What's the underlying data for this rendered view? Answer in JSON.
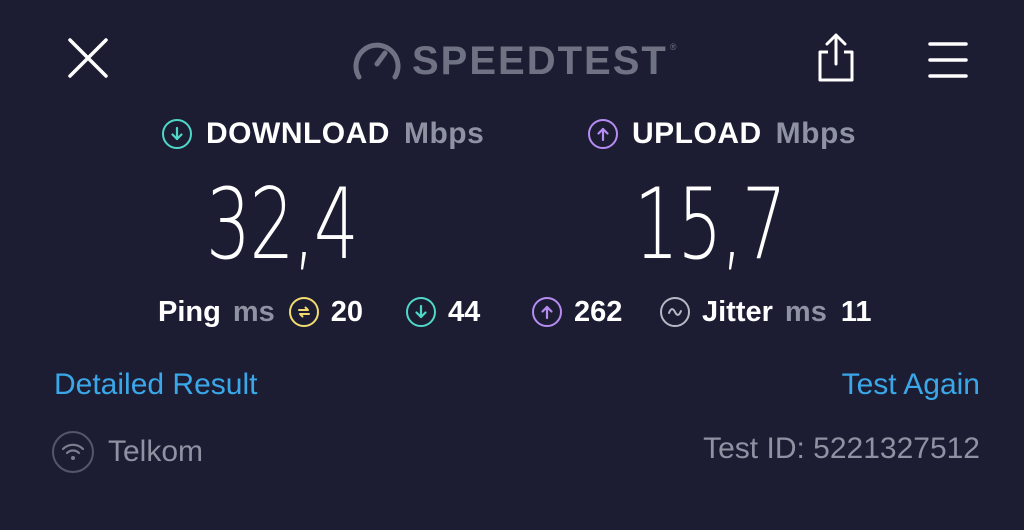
{
  "app": {
    "brand": "SPEEDTEST",
    "brand_mark": "®"
  },
  "download": {
    "label": "DOWNLOAD",
    "unit": "Mbps",
    "value": "32,4"
  },
  "upload": {
    "label": "UPLOAD",
    "unit": "Mbps",
    "value": "15,7"
  },
  "ping": {
    "label": "Ping",
    "unit": "ms",
    "idle": "20",
    "download": "44",
    "upload": "262"
  },
  "jitter": {
    "label": "Jitter",
    "unit": "ms",
    "value": "11"
  },
  "links": {
    "detailed": "Detailed Result",
    "test_again": "Test Again"
  },
  "footer": {
    "isp": "Telkom",
    "test_id": "Test ID: 5221327512"
  },
  "colors": {
    "background": "#1c1d33",
    "download_accent": "#4fd8c8",
    "upload_accent": "#b68cf2",
    "ping_accent": "#f0dc6e",
    "link": "#3aa8e8",
    "muted": "#8f92a2"
  },
  "icons": {
    "close": "close-icon",
    "logo": "gauge-icon",
    "share": "share-icon",
    "menu": "menu-icon",
    "download": "arrow-down-circle-icon",
    "upload": "arrow-up-circle-icon",
    "ping": "ping-icon",
    "jitter": "jitter-icon",
    "wifi": "wifi-icon"
  }
}
